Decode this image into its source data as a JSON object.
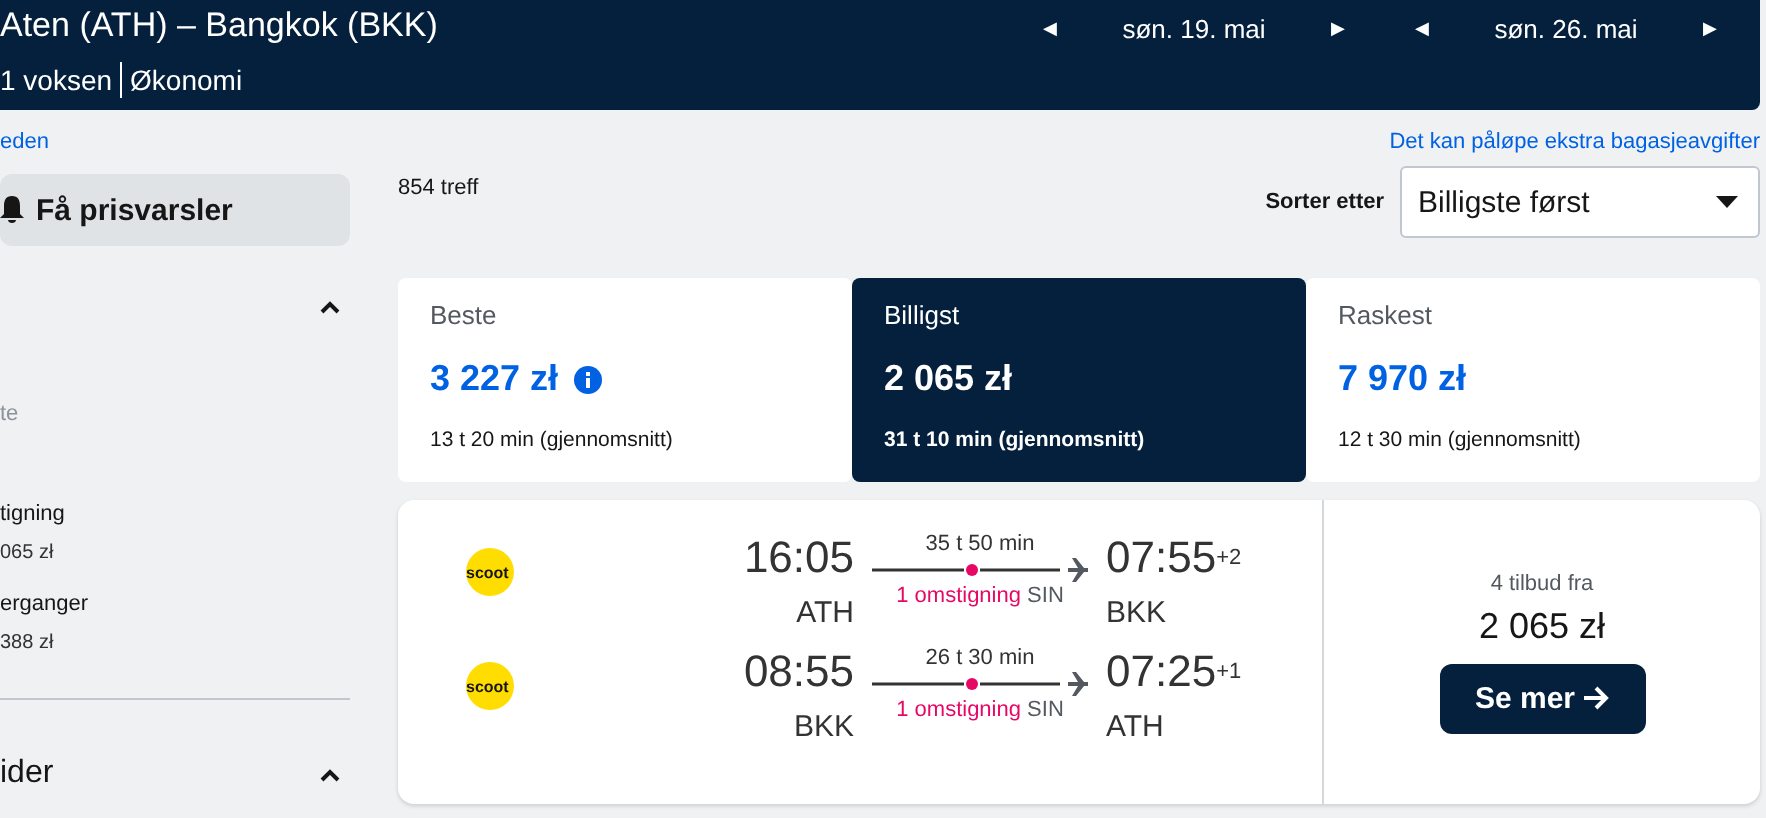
{
  "header": {
    "title": "Aten (ATH) – Bangkok (BKK)",
    "passengers": "1 voksen",
    "cabin": "Økonomi",
    "dates": [
      {
        "label": "søn. 19. mai",
        "prev": "◀",
        "next": "▶"
      },
      {
        "label": "søn. 26. mai",
        "prev": "◀",
        "next": "▶"
      }
    ]
  },
  "sidebar": {
    "link": "eden",
    "alert_button": "Få prisvarsler",
    "section_1": {
      "expanded": true,
      "option": {
        "label": "te",
        "disabled": true
      },
      "filters": [
        {
          "label": "tigning",
          "price": "065 zł"
        },
        {
          "label": "erganger",
          "price": "388 zł"
        }
      ]
    },
    "section_2": {
      "title": "ider",
      "expanded": true
    }
  },
  "results_count": "854 treff",
  "baggage_note": "Det kan påløpe ekstra bagasjeavgifter",
  "sort": {
    "label": "Sorter etter",
    "value": "Billigste først"
  },
  "tabs": [
    {
      "label": "Beste",
      "price": "3 227 zł",
      "duration": "13 t 20 min (gjennomsnitt)",
      "info": true,
      "selected": false
    },
    {
      "label": "Billigst",
      "price": "2 065 zł",
      "duration": "31 t 10 min (gjennomsnitt)",
      "info": false,
      "selected": true
    },
    {
      "label": "Raskest",
      "price": "7 970 zł",
      "duration": "12 t 30 min (gjennomsnitt)",
      "info": false,
      "selected": false
    }
  ],
  "results": [
    {
      "legs": [
        {
          "airline": "scoot",
          "depart": "16:05",
          "from": "ATH",
          "duration": "35 t 50 min",
          "stops": "1 omstigning",
          "via": "SIN",
          "arrive": "07:55",
          "arrive_offset": "+2",
          "to": "BKK"
        },
        {
          "airline": "scoot",
          "depart": "08:55",
          "from": "BKK",
          "duration": "26 t 30 min",
          "stops": "1 omstigning",
          "via": "SIN",
          "arrive": "07:25",
          "arrive_offset": "+1",
          "to": "ATH"
        }
      ],
      "offers": "4 tilbud fra",
      "price": "2 065 zł",
      "button": "Se mer"
    }
  ]
}
